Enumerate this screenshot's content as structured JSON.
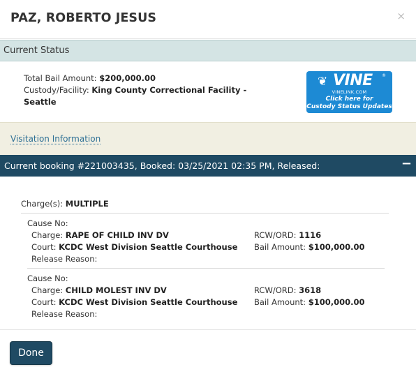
{
  "header": {
    "title": "PAZ, ROBERTO JESUS",
    "close_glyph": "×"
  },
  "status_bar": {
    "label": "Current Status"
  },
  "summary": {
    "bail_label": "Total Bail Amount:",
    "bail_value": "$200,000.00",
    "custody_label": "Custody/Facility:",
    "custody_value_line1": "King County Correctional Facility -",
    "custody_value_line2": "Seattle"
  },
  "vine": {
    "word": "VINE",
    "reg": "®",
    "site": "VINELINK.COM",
    "click_line1": "Click here for",
    "click_line2": "Custody Status Updates",
    "color": "#1d8ad4"
  },
  "visitation": {
    "link": "Visitation Information"
  },
  "booking": {
    "label": "Current booking #221003435, Booked: 03/25/2021 02:35 PM, Released:",
    "toggle": "−",
    "color": "#1f4a63"
  },
  "charges": {
    "label": "Charge(s):",
    "value": "MULTIPLE",
    "items": [
      {
        "cause_label": "Cause No:",
        "charge_label": "Charge:",
        "charge_value": "RAPE OF CHILD INV DV",
        "court_label": "Court:",
        "court_value": "KCDC West Division Seattle Courthouse",
        "release_label": "Release Reason:",
        "rcw_label": "RCW/ORD:",
        "rcw_value": "1116",
        "bail_label": "Bail Amount:",
        "bail_value": "$100,000.00"
      },
      {
        "cause_label": "Cause No:",
        "charge_label": "Charge:",
        "charge_value": "CHILD MOLEST INV DV",
        "court_label": "Court:",
        "court_value": "KCDC West Division Seattle Courthouse",
        "release_label": "Release Reason:",
        "rcw_label": "RCW/ORD:",
        "rcw_value": "3618",
        "bail_label": "Bail Amount:",
        "bail_value": "$100,000.00"
      }
    ]
  },
  "footer": {
    "done_label": "Done"
  }
}
